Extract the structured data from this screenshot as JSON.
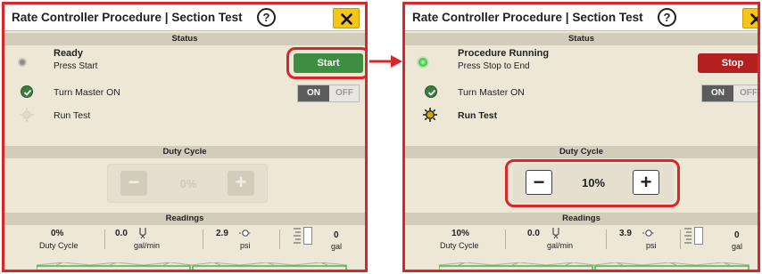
{
  "colors": {
    "frame_red": "#d9262b",
    "start_green": "#3e8e41",
    "stop_red": "#b3201f",
    "led_green": "#5fd15f",
    "check_green": "#3a7d3c",
    "close_yellow": "#f5c518"
  },
  "icons": {
    "help": "question-circle-icon",
    "close": "close-x-icon",
    "check": "check-circle-icon",
    "flow": "flow-icon",
    "pressure": "pressure-icon",
    "volume": "tank-level-icon"
  },
  "left": {
    "title": "Rate Controller Procedure | Section Test",
    "help_label": "?",
    "status_header": "Status",
    "status_title": "Ready",
    "status_sub": "Press Start",
    "action_label": "Start",
    "row1_label": "Turn Master ON",
    "toggle_on": "ON",
    "toggle_off": "OFF",
    "row2_label": "Run Test",
    "duty_header": "Duty Cycle",
    "minus_label": "−",
    "plus_label": "+",
    "duty_value": "0%",
    "readings_header": "Readings",
    "readings": {
      "duty_value": "0%",
      "duty_unit": "Duty Cycle",
      "flow_value": "0.0",
      "flow_unit": "gal/min",
      "pressure_value": "2.9",
      "pressure_unit": "psi",
      "volume_value": "0",
      "volume_unit": "gal"
    }
  },
  "right": {
    "title": "Rate Controller Procedure | Section Test",
    "help_label": "?",
    "status_header": "Status",
    "status_title": "Procedure Running",
    "status_sub": "Press Stop to End",
    "action_label": "Stop",
    "row1_label": "Turn Master ON",
    "toggle_on": "ON",
    "toggle_off": "OFF",
    "row2_label": "Run Test",
    "duty_header": "Duty Cycle",
    "minus_label": "−",
    "plus_label": "+",
    "duty_value": "10%",
    "readings_header": "Readings",
    "readings": {
      "duty_value": "10%",
      "duty_unit": "Duty Cycle",
      "flow_value": "0.0",
      "flow_unit": "gal/min",
      "pressure_value": "3.9",
      "pressure_unit": "psi",
      "volume_value": "0",
      "volume_unit": "gal"
    }
  }
}
